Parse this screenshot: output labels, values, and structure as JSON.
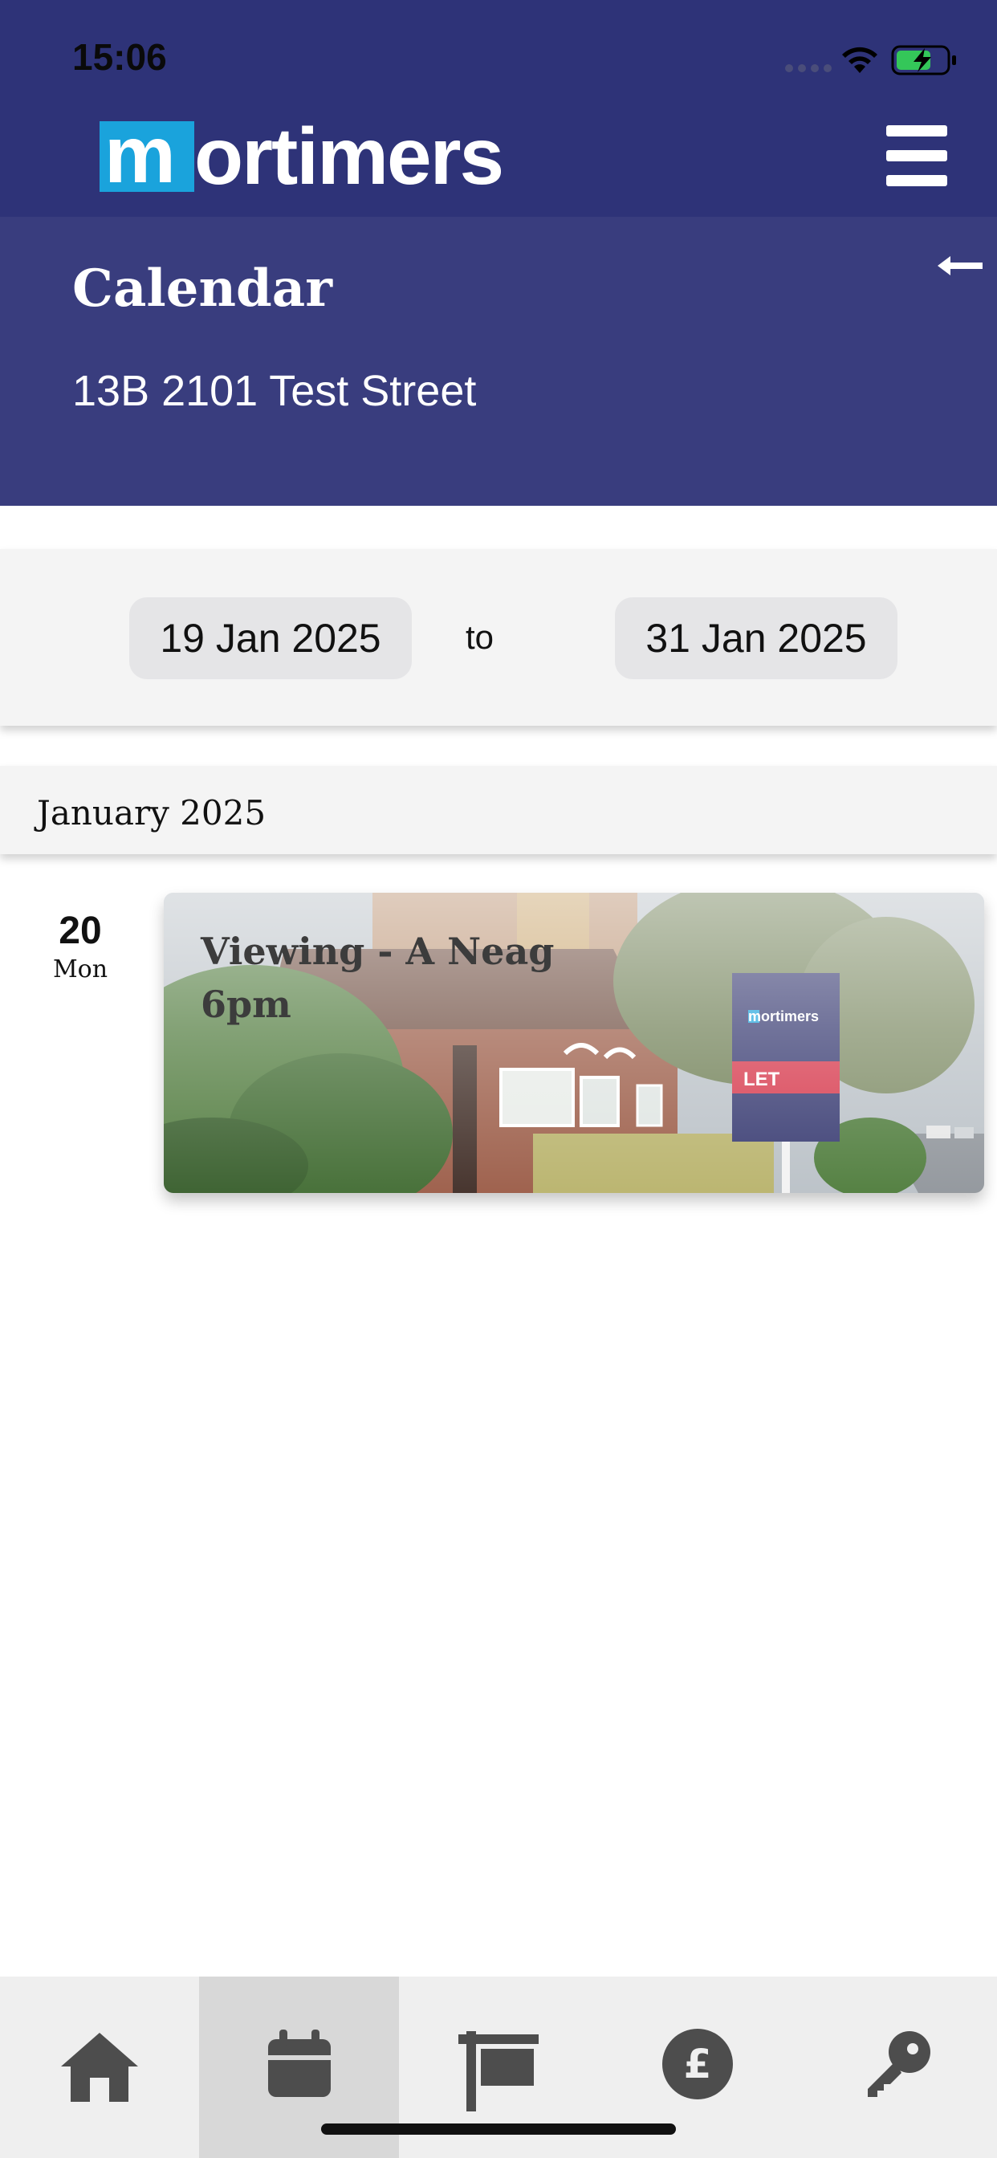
{
  "status_bar": {
    "time": "15:06"
  },
  "app_bar": {
    "logo_highlight": "m",
    "logo_rest": "ortimers"
  },
  "header": {
    "title": "Calendar",
    "address": "13B 2101 Test Street"
  },
  "date_range": {
    "from": "19 Jan 2025",
    "separator": "to",
    "to": "31 Jan 2025"
  },
  "month": {
    "label": "January 2025"
  },
  "events": [
    {
      "day_number": "20",
      "day_name": "Mon",
      "title": "Viewing - A Neag",
      "time": "6pm",
      "sign_brand": "mortimers",
      "sign_label": "LET"
    }
  ],
  "bottom_nav": {
    "items": [
      {
        "icon": "home-icon"
      },
      {
        "icon": "calendar-icon",
        "active": true
      },
      {
        "icon": "sign-board-icon"
      },
      {
        "icon": "pound-icon"
      },
      {
        "icon": "key-icon"
      }
    ]
  },
  "colors": {
    "app_bar": "#2e3378",
    "header": "#393d7e",
    "logo_accent": "#1aa3dc",
    "nav_background": "#efefef",
    "nav_active": "#d8d8d8"
  }
}
